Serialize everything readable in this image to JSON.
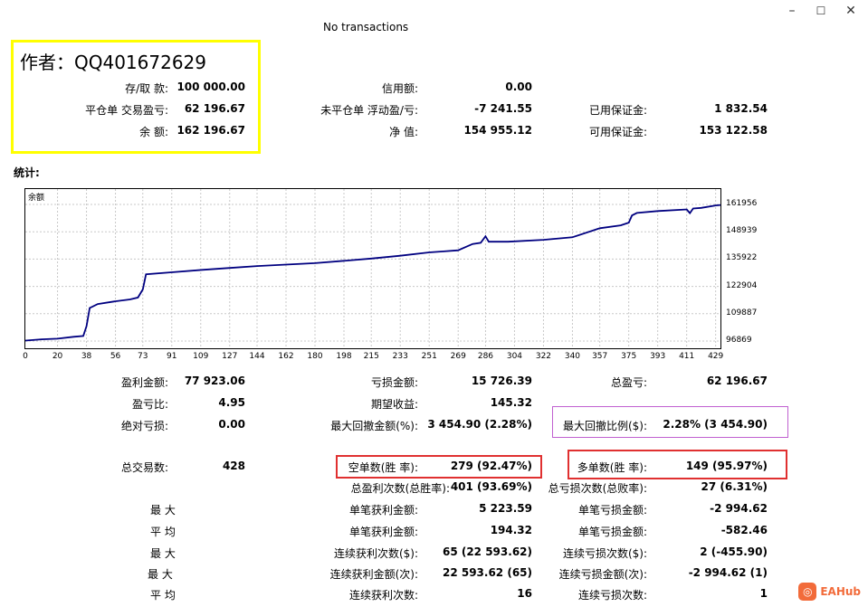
{
  "window": {
    "title": "No transactions",
    "minimize_glyph": "–",
    "maximize_glyph": "☐",
    "close_glyph": "✕"
  },
  "author": "作者：QQ401672629",
  "account": {
    "deposit_label": "存/取 款:",
    "deposit": "100 000.00",
    "closed_pl_label": "平仓单 交易盈亏:",
    "closed_pl": "62 196.67",
    "balance_label": "余 额:",
    "balance": "162 196.67",
    "credit_label": "信用额:",
    "credit": "0.00",
    "floating_pl_label": "未平仓单 浮动盈/亏:",
    "floating_pl": "-7 241.55",
    "equity_label": "净 值:",
    "equity": "154 955.12",
    "margin_label": "已用保证金:",
    "margin": "1 832.54",
    "free_margin_label": "可用保证金:",
    "free_margin": "153 122.58"
  },
  "stats_title": "统计:",
  "chart_data": {
    "type": "line",
    "series": [
      {
        "name": "余额",
        "x": [
          0,
          10,
          20,
          30,
          36,
          38,
          40,
          45,
          55,
          65,
          70,
          73,
          75,
          90,
          110,
          127,
          144,
          162,
          180,
          198,
          215,
          233,
          251,
          260,
          269,
          278,
          283,
          286,
          288,
          300,
          322,
          340,
          357,
          370,
          375,
          377,
          380,
          393,
          411,
          413,
          415,
          420,
          429,
          432
        ],
        "y": [
          97100,
          97700,
          98000,
          98900,
          99300,
          104000,
          112600,
          114500,
          115700,
          116700,
          117600,
          121500,
          128700,
          129600,
          130800,
          131700,
          132600,
          133300,
          134000,
          135100,
          136200,
          137500,
          139100,
          139600,
          140100,
          143100,
          143700,
          146800,
          144200,
          144200,
          145100,
          146300,
          150600,
          152000,
          153300,
          156700,
          157900,
          158800,
          159600,
          157800,
          160000,
          160300,
          161500,
          161700
        ]
      }
    ],
    "xticks": [
      "0",
      "20",
      "38",
      "56",
      "73",
      "91",
      "109",
      "127",
      "144",
      "162",
      "180",
      "198",
      "215",
      "233",
      "251",
      "269",
      "286",
      "304",
      "322",
      "340",
      "357",
      "375",
      "393",
      "411",
      "429"
    ],
    "yticks": [
      "161956",
      "148939",
      "135922",
      "122904",
      "109887",
      "96869"
    ],
    "xlim": [
      0,
      432
    ],
    "ylim": [
      96869,
      161956
    ],
    "grid": true,
    "color": "#000080"
  },
  "stats": {
    "gross_profit_label": "盈利金额:",
    "gross_profit": "77 923.06",
    "gross_loss_label": "亏损金额:",
    "gross_loss": "15 726.39",
    "total_net_label": "总盈亏:",
    "total_net": "62 196.67",
    "profit_factor_label": "盈亏比:",
    "profit_factor": "4.95",
    "expected_payoff_label": "期望收益:",
    "expected_payoff": "145.32",
    "abs_drawdown_label": "绝对亏损:",
    "abs_drawdown": "0.00",
    "max_drawdown_label": "最大回撤金额(%):",
    "max_drawdown": "3 454.90 (2.28%)",
    "rel_drawdown_label": "最大回撤比例($):",
    "rel_drawdown": "2.28% (3 454.90)",
    "total_trades_label": "总交易数:",
    "total_trades": "428",
    "short_label": "空单数(胜 率):",
    "short": "279 (92.47%)",
    "long_label": "多单数(胜 率):",
    "long": "149 (95.97%)",
    "win_count_label": "总盈利次数(总胜率):",
    "win_count": "401 (93.69%)",
    "loss_count_label": "总亏损次数(总败率):",
    "loss_count": "27 (6.31%)",
    "max_label": "最 大",
    "avg_label": "平 均",
    "max_win_label": "单笔获利金额:",
    "max_win": "5 223.59",
    "max_loss_label": "单笔亏损金额:",
    "max_loss": "-2 994.62",
    "avg_win_label": "单笔获利金额:",
    "avg_win": "194.32",
    "avg_loss_label": "单笔亏损金额:",
    "avg_loss": "-582.46",
    "max_cons_wins_label": "连续获利次数($):",
    "max_cons_wins": "65 (22 593.62)",
    "max_cons_losses_label": "连续亏损次数($):",
    "max_cons_losses": "2 (-455.90)",
    "max_cons_profit_label": "连续获利金额(次):",
    "max_cons_profit": "22 593.62 (65)",
    "max_cons_loss_label": "连续亏损金额(次):",
    "max_cons_loss": "-2 994.62 (1)",
    "avg_cons_wins_label": "连续获利次数:",
    "avg_cons_wins": "16",
    "avg_cons_losses_label": "连续亏损次数:",
    "avg_cons_losses": "1"
  },
  "logo_text": "EAHub",
  "colors": {
    "yellow_box": "#ffff00",
    "red_box": "#e03030",
    "purple_box": "#c060d0",
    "line": "#000080",
    "logo": "#f26b3a"
  }
}
